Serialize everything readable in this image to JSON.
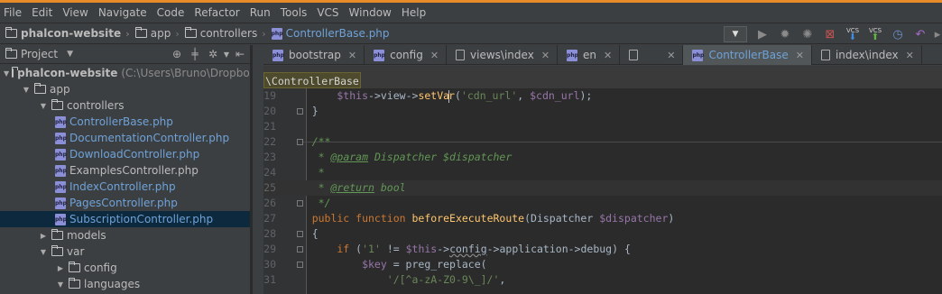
{
  "menu": [
    "File",
    "Edit",
    "View",
    "Navigate",
    "Code",
    "Refactor",
    "Run",
    "Tools",
    "VCS",
    "Window",
    "Help"
  ],
  "breadcrumb": [
    {
      "label": "phalcon-website",
      "type": "folder",
      "bold": true
    },
    {
      "label": "app",
      "type": "folder"
    },
    {
      "label": "controllers",
      "type": "folder"
    },
    {
      "label": "ControllerBase.php",
      "type": "php",
      "active": true
    }
  ],
  "toolbar": {
    "vcs_label_1": "VCS",
    "vcs_label_2": "VCS",
    "icons": [
      "run-configuration-dropdown",
      "run-icon",
      "debug-icon",
      "coverage-icon",
      "stop-icon",
      "vcs-update-icon",
      "vcs-commit-icon",
      "history-icon",
      "revert-icon"
    ]
  },
  "project_panel": {
    "title": "Project",
    "tools": [
      "sync-icon",
      "collapse-icon",
      "settings-icon",
      "hide-icon"
    ]
  },
  "tree": [
    {
      "depth": 0,
      "label": "phalcon-website",
      "path": "(C:\\Users\\Bruno\\Dropbox\\We",
      "kind": "folder",
      "open": true,
      "bold": true
    },
    {
      "depth": 1,
      "label": "app",
      "kind": "folder",
      "open": true
    },
    {
      "depth": 2,
      "label": "controllers",
      "kind": "folder",
      "open": true
    },
    {
      "depth": 3,
      "label": "ControllerBase.php",
      "kind": "php"
    },
    {
      "depth": 3,
      "label": "DocumentationController.php",
      "kind": "php"
    },
    {
      "depth": 3,
      "label": "DownloadController.php",
      "kind": "php"
    },
    {
      "depth": 3,
      "label": "ExamplesController.php",
      "kind": "php",
      "dim": true
    },
    {
      "depth": 3,
      "label": "IndexController.php",
      "kind": "php"
    },
    {
      "depth": 3,
      "label": "PagesController.php",
      "kind": "php"
    },
    {
      "depth": 3,
      "label": "SubscriptionController.php",
      "kind": "php",
      "selected": true
    },
    {
      "depth": 2,
      "label": "models",
      "kind": "folder",
      "open": false
    },
    {
      "depth": 2,
      "label": "var",
      "kind": "folder",
      "open": true
    },
    {
      "depth": 3,
      "label": "config",
      "kind": "folder",
      "open": false
    },
    {
      "depth": 3,
      "label": "languages",
      "kind": "folder",
      "open": true
    }
  ],
  "tabs": [
    {
      "label": "bootstrap",
      "icon": "php"
    },
    {
      "label": "config",
      "icon": "php"
    },
    {
      "label": "views\\index",
      "icon": "file"
    },
    {
      "label": "en",
      "icon": "php"
    },
    {
      "label": "",
      "icon": "file"
    },
    {
      "label": "ControllerBase",
      "icon": "php",
      "active": true
    },
    {
      "label": "index\\index",
      "icon": "file"
    }
  ],
  "editor": {
    "class_crumb": "\\ControllerBase",
    "lines": [
      {
        "num": "19",
        "fold": false,
        "tokens": [
          [
            "var",
            "        $this"
          ],
          [
            "plain",
            "->"
          ],
          [
            "plain",
            "view"
          ],
          [
            "plain",
            "->"
          ],
          [
            "fn",
            "setVa"
          ],
          [
            "caret",
            ""
          ],
          [
            "fn",
            "r"
          ],
          [
            "plain",
            "("
          ],
          [
            "str",
            "'cdn_url'"
          ],
          [
            "plain",
            ", "
          ],
          [
            "var",
            "$cdn_url"
          ],
          [
            "plain",
            ");"
          ]
        ]
      },
      {
        "num": "20",
        "fold": true,
        "tokens": [
          [
            "plain",
            "    }"
          ]
        ]
      },
      {
        "num": "21",
        "fold": false,
        "tokens": []
      },
      {
        "num": "22",
        "fold": true,
        "tokens": [
          [
            "doc",
            "    /**"
          ]
        ]
      },
      {
        "num": "23",
        "fold": false,
        "tokens": [
          [
            "doc",
            "     * "
          ],
          [
            "tag",
            "@param"
          ],
          [
            "doc",
            " Dispatcher $dispatcher"
          ]
        ]
      },
      {
        "num": "24",
        "fold": false,
        "tokens": [
          [
            "doc",
            "     *"
          ]
        ]
      },
      {
        "num": "25",
        "fold": false,
        "current": true,
        "tokens": [
          [
            "doc",
            "     * "
          ],
          [
            "tag",
            "@return"
          ],
          [
            "doc",
            " bool"
          ]
        ]
      },
      {
        "num": "26",
        "fold": true,
        "tokens": [
          [
            "doc",
            "     */"
          ]
        ]
      },
      {
        "num": "27",
        "fold": false,
        "tokens": [
          [
            "kw",
            "    public function "
          ],
          [
            "fn",
            "beforeExecuteRoute"
          ],
          [
            "plain",
            "(Dispatcher "
          ],
          [
            "var",
            "$dispatcher"
          ],
          [
            "plain",
            ")"
          ]
        ]
      },
      {
        "num": "28",
        "fold": true,
        "tokens": [
          [
            "plain",
            "    {"
          ]
        ]
      },
      {
        "num": "29",
        "fold": true,
        "tokens": [
          [
            "kw",
            "        if "
          ],
          [
            "plain",
            "("
          ],
          [
            "str",
            "'1'"
          ],
          [
            "plain",
            " != "
          ],
          [
            "var",
            "$this"
          ],
          [
            "plain",
            "->"
          ],
          [
            "und",
            "config"
          ],
          [
            "plain",
            "->application->debug) {"
          ]
        ]
      },
      {
        "num": "30",
        "fold": true,
        "tokens": [
          [
            "var",
            "            $key"
          ],
          [
            "plain",
            " = preg_replace("
          ]
        ]
      },
      {
        "num": "31",
        "fold": false,
        "tokens": [
          [
            "str",
            "                '/[^a-zA-Z0-9\\_]/'"
          ],
          [
            "plain",
            ","
          ]
        ]
      }
    ]
  }
}
